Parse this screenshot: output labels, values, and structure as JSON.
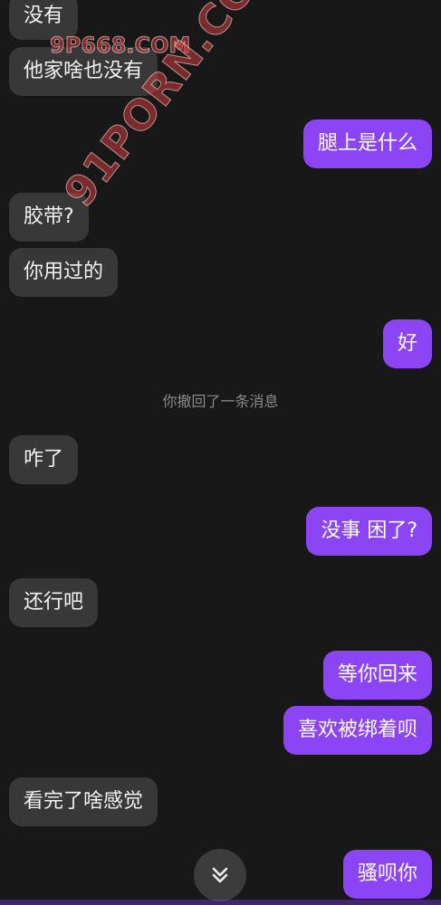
{
  "chat": {
    "messages": [
      {
        "side": "in",
        "text": "没有"
      },
      {
        "side": "in",
        "text": "他家啥也没有"
      },
      {
        "side": "out",
        "text": "腿上是什么"
      },
      {
        "side": "in",
        "text": "胶带?"
      },
      {
        "side": "in",
        "text": "你用过的"
      },
      {
        "side": "out",
        "text": "好"
      },
      {
        "side": "in",
        "text": "咋了"
      },
      {
        "side": "out",
        "text": "没事 困了?"
      },
      {
        "side": "in",
        "text": "还行吧"
      },
      {
        "side": "out",
        "text": "等你回来"
      },
      {
        "side": "out",
        "text": "喜欢被绑着呗"
      },
      {
        "side": "in",
        "text": "看完了啥感觉"
      },
      {
        "side": "out",
        "text": "骚呗你"
      }
    ],
    "recall_notice": "你撤回了一条消息"
  },
  "watermarks": {
    "top": "9P668.COM",
    "diagonal": "91PORN.COM"
  },
  "controls": {
    "scroll_down_icon": "double-chevron-down-icon"
  },
  "colors": {
    "background": "#181818",
    "incoming_bubble": "#383838",
    "outgoing_bubble": "#8b45f5"
  }
}
